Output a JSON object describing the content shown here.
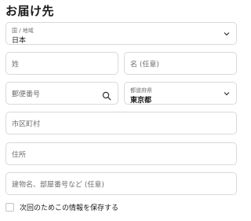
{
  "section": {
    "title": "お届け先"
  },
  "country": {
    "label": "国 / 地域",
    "value": "日本"
  },
  "last_name": {
    "placeholder": "姓"
  },
  "first_name": {
    "placeholder": "名 (任意)"
  },
  "postal_code": {
    "placeholder": "郵便番号"
  },
  "prefecture": {
    "label": "都道府県",
    "value": "東京都"
  },
  "city": {
    "placeholder": "市区町村"
  },
  "address": {
    "placeholder": "住所"
  },
  "building": {
    "placeholder": "建物名、部屋番号など (任意)"
  },
  "save_info": {
    "label": "次回のためこの情報を保存する",
    "checked": false
  },
  "icons": {
    "dropdown": "chevron-down-icon",
    "search": "search-icon"
  }
}
